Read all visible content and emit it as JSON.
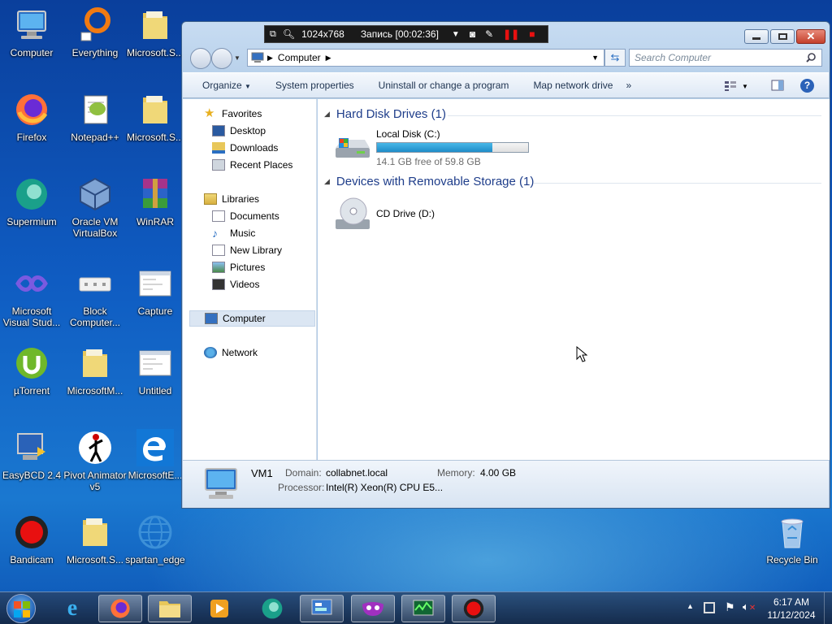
{
  "desktop": {
    "icons": [
      {
        "label": "Computer"
      },
      {
        "label": "Everything"
      },
      {
        "label": "Microsoft.S..."
      },
      {
        "label": "Firefox"
      },
      {
        "label": "Notepad++"
      },
      {
        "label": "Microsoft.S..."
      },
      {
        "label": "Supermium"
      },
      {
        "label": "Oracle VM VirtualBox"
      },
      {
        "label": "WinRAR"
      },
      {
        "label": "Microsoft Visual Stud..."
      },
      {
        "label": "Block Computer..."
      },
      {
        "label": "Capture"
      },
      {
        "label": "µTorrent"
      },
      {
        "label": "MicrosoftM..."
      },
      {
        "label": "Untitled"
      },
      {
        "label": "EasyBCD 2.4"
      },
      {
        "label": "Pivot Animator v5"
      },
      {
        "label": "MicrosoftE..."
      },
      {
        "label": "Bandicam"
      },
      {
        "label": "Microsoft.S..."
      },
      {
        "label": "spartan_edge"
      },
      {
        "label": "Recycle Bin"
      }
    ]
  },
  "recorder": {
    "resolution": "1024x768",
    "status": "Запись [00:02:36]"
  },
  "explorer": {
    "address": "Computer",
    "search_placeholder": "Search Computer",
    "toolbar": {
      "organize": "Organize",
      "system_properties": "System properties",
      "uninstall": "Uninstall or change a program",
      "map_drive": "Map network drive",
      "more": "»"
    },
    "nav": {
      "favorites": "Favorites",
      "desktop": "Desktop",
      "downloads": "Downloads",
      "recent": "Recent Places",
      "libraries": "Libraries",
      "documents": "Documents",
      "music": "Music",
      "new_library": "New Library",
      "pictures": "Pictures",
      "videos": "Videos",
      "computer": "Computer",
      "network": "Network"
    },
    "groups": {
      "hdd": "Hard Disk Drives (1)",
      "removable": "Devices with Removable Storage (1)"
    },
    "drives": {
      "c_name": "Local Disk (C:)",
      "c_free": "14.1 GB free of 59.8 GB",
      "c_used_fraction": 0.764,
      "d_name": "CD Drive (D:)"
    },
    "details": {
      "name": "VM1",
      "domain_label": "Domain:",
      "domain": "collabnet.local",
      "memory_label": "Memory:",
      "memory": "4.00 GB",
      "processor_label": "Processor:",
      "processor": "Intel(R) Xeon(R) CPU E5..."
    }
  },
  "taskbar": {
    "time": "6:17 AM",
    "date": "11/12/2024"
  },
  "colors": {
    "accent": "#1e3d8a",
    "progress": "#26a0da",
    "desktop": "#0f5cc2"
  }
}
